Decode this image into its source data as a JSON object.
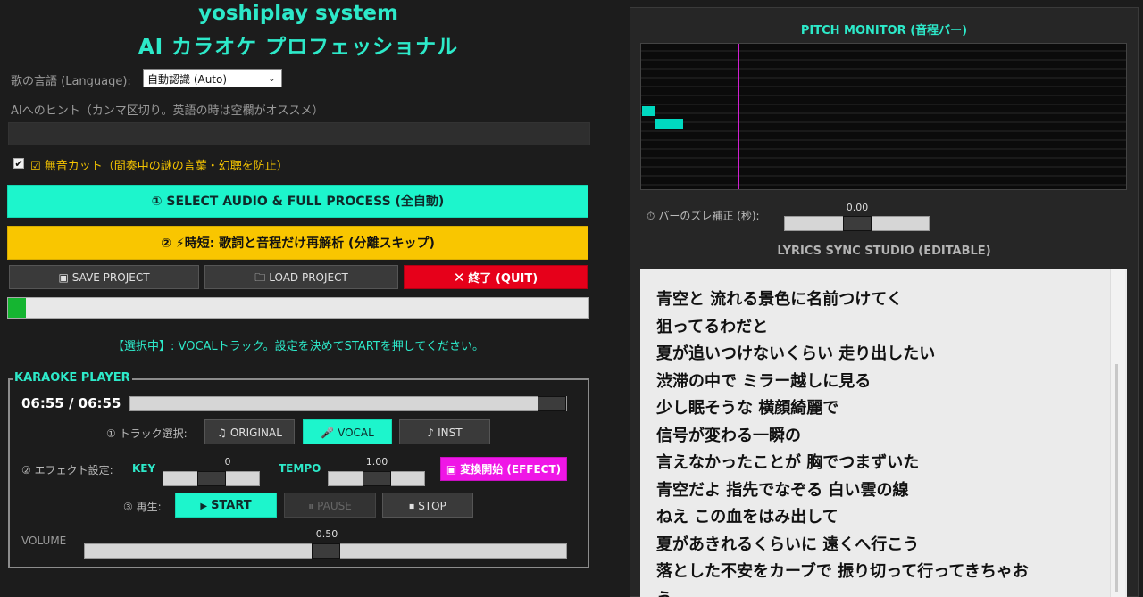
{
  "header": {
    "title_line1": "yoshiplay system",
    "title_line2": "AI カラオケ プロフェッショナル"
  },
  "language": {
    "label": "歌の言語 (Language):",
    "selected": "自動認識 (Auto)"
  },
  "hint": {
    "label": "AIへのヒント（カンマ区切り。英語の時は空欄がオススメ）",
    "value": ""
  },
  "silence_cut": {
    "checked": true,
    "label": "☑ 無音カット（間奏中の謎の言葉・幻聴を防止）"
  },
  "buttons": {
    "full_process": "① SELECT AUDIO & FULL PROCESS (全自動)",
    "quick": "② ⚡時短: 歌詞と音程だけ再解析 (分離スキップ)",
    "save": "SAVE PROJECT",
    "load": "LOAD PROJECT",
    "quit": "終了 (QUIT)"
  },
  "progress": {
    "value": 0.03
  },
  "status_text": "【選択中】: VOCALトラック。設定を決めてSTARTを押してください。",
  "player": {
    "legend": "KARAOKE PLAYER",
    "time": "06:55 / 06:55",
    "seek": 1.0,
    "track_label": "① トラック選択:",
    "tracks": [
      "ORIGINAL",
      "VOCAL",
      "INST"
    ],
    "selected_track": "VOCAL",
    "effect_label": "② エフェクト設定:",
    "key_label": "KEY",
    "key_value": "0",
    "key_pos": 0.5,
    "tempo_label": "TEMPO",
    "tempo_value": "1.00",
    "tempo_pos": 0.5,
    "effect_button": "変換開始 (EFFECT)",
    "play_label": "③ 再生:",
    "start": "START",
    "pause": "PAUSE",
    "stop": "STOP",
    "volume_label": "VOLUME",
    "volume_value": "0.50",
    "volume_pos": 0.5
  },
  "pitch_monitor": {
    "title": "PITCH MONITOR (音程バー)",
    "offset_label": "バーのズレ補正 (秒):",
    "offset_value": "0.00",
    "offset_pos": 0.5
  },
  "lyrics": {
    "title": "LYRICS SYNC STUDIO (EDITABLE)",
    "lines": [
      "青空と 流れる景色に名前つけてく",
      "狙ってるわだと",
      "夏が追いつけないくらい 走り出したい",
      "渋滞の中で ミラー越しに見る",
      "少し眠そうな 横顔綺麗で",
      "信号が変わる一瞬の",
      "言えなかったことが 胸でつまずいた",
      "青空だよ 指先でなぞる 白い雲の線",
      "ねえ この血をはみ出して",
      "夏があきれるくらいに 遠くへ行こう",
      "落とした不安をカーブで 振り切って行ってきちゃお",
      "う"
    ]
  },
  "colors": {
    "accent": "#1df5cc",
    "warning": "#f9c600",
    "danger": "#e6001a",
    "effect": "#ef16e6",
    "playhead": "#d020d0"
  },
  "icons": {
    "save": "save-icon",
    "load": "folder-icon",
    "quit": "x-icon",
    "original": "music-note-icon",
    "vocal": "mic-icon",
    "inst": "guitar-icon",
    "start": "play-icon",
    "pause": "pause-icon",
    "stop": "stop-icon",
    "effect": "effect-icon",
    "offset": "clock-icon"
  }
}
